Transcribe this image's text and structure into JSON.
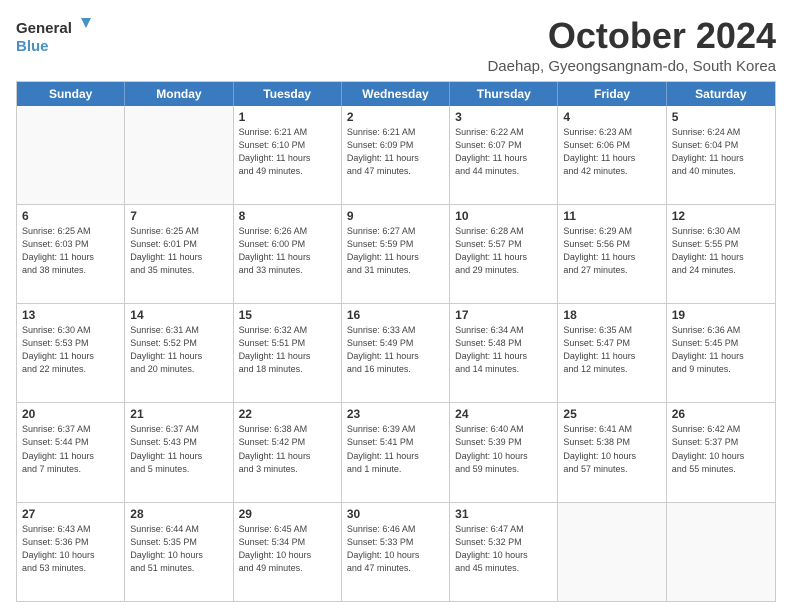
{
  "logo": {
    "line1": "General",
    "line2": "Blue",
    "icon_color": "#4a90c4"
  },
  "header": {
    "month": "October 2024",
    "location": "Daehap, Gyeongsangnam-do, South Korea"
  },
  "weekdays": [
    "Sunday",
    "Monday",
    "Tuesday",
    "Wednesday",
    "Thursday",
    "Friday",
    "Saturday"
  ],
  "rows": [
    [
      {
        "num": "",
        "info": ""
      },
      {
        "num": "",
        "info": ""
      },
      {
        "num": "1",
        "info": "Sunrise: 6:21 AM\nSunset: 6:10 PM\nDaylight: 11 hours\nand 49 minutes."
      },
      {
        "num": "2",
        "info": "Sunrise: 6:21 AM\nSunset: 6:09 PM\nDaylight: 11 hours\nand 47 minutes."
      },
      {
        "num": "3",
        "info": "Sunrise: 6:22 AM\nSunset: 6:07 PM\nDaylight: 11 hours\nand 44 minutes."
      },
      {
        "num": "4",
        "info": "Sunrise: 6:23 AM\nSunset: 6:06 PM\nDaylight: 11 hours\nand 42 minutes."
      },
      {
        "num": "5",
        "info": "Sunrise: 6:24 AM\nSunset: 6:04 PM\nDaylight: 11 hours\nand 40 minutes."
      }
    ],
    [
      {
        "num": "6",
        "info": "Sunrise: 6:25 AM\nSunset: 6:03 PM\nDaylight: 11 hours\nand 38 minutes."
      },
      {
        "num": "7",
        "info": "Sunrise: 6:25 AM\nSunset: 6:01 PM\nDaylight: 11 hours\nand 35 minutes."
      },
      {
        "num": "8",
        "info": "Sunrise: 6:26 AM\nSunset: 6:00 PM\nDaylight: 11 hours\nand 33 minutes."
      },
      {
        "num": "9",
        "info": "Sunrise: 6:27 AM\nSunset: 5:59 PM\nDaylight: 11 hours\nand 31 minutes."
      },
      {
        "num": "10",
        "info": "Sunrise: 6:28 AM\nSunset: 5:57 PM\nDaylight: 11 hours\nand 29 minutes."
      },
      {
        "num": "11",
        "info": "Sunrise: 6:29 AM\nSunset: 5:56 PM\nDaylight: 11 hours\nand 27 minutes."
      },
      {
        "num": "12",
        "info": "Sunrise: 6:30 AM\nSunset: 5:55 PM\nDaylight: 11 hours\nand 24 minutes."
      }
    ],
    [
      {
        "num": "13",
        "info": "Sunrise: 6:30 AM\nSunset: 5:53 PM\nDaylight: 11 hours\nand 22 minutes."
      },
      {
        "num": "14",
        "info": "Sunrise: 6:31 AM\nSunset: 5:52 PM\nDaylight: 11 hours\nand 20 minutes."
      },
      {
        "num": "15",
        "info": "Sunrise: 6:32 AM\nSunset: 5:51 PM\nDaylight: 11 hours\nand 18 minutes."
      },
      {
        "num": "16",
        "info": "Sunrise: 6:33 AM\nSunset: 5:49 PM\nDaylight: 11 hours\nand 16 minutes."
      },
      {
        "num": "17",
        "info": "Sunrise: 6:34 AM\nSunset: 5:48 PM\nDaylight: 11 hours\nand 14 minutes."
      },
      {
        "num": "18",
        "info": "Sunrise: 6:35 AM\nSunset: 5:47 PM\nDaylight: 11 hours\nand 12 minutes."
      },
      {
        "num": "19",
        "info": "Sunrise: 6:36 AM\nSunset: 5:45 PM\nDaylight: 11 hours\nand 9 minutes."
      }
    ],
    [
      {
        "num": "20",
        "info": "Sunrise: 6:37 AM\nSunset: 5:44 PM\nDaylight: 11 hours\nand 7 minutes."
      },
      {
        "num": "21",
        "info": "Sunrise: 6:37 AM\nSunset: 5:43 PM\nDaylight: 11 hours\nand 5 minutes."
      },
      {
        "num": "22",
        "info": "Sunrise: 6:38 AM\nSunset: 5:42 PM\nDaylight: 11 hours\nand 3 minutes."
      },
      {
        "num": "23",
        "info": "Sunrise: 6:39 AM\nSunset: 5:41 PM\nDaylight: 11 hours\nand 1 minute."
      },
      {
        "num": "24",
        "info": "Sunrise: 6:40 AM\nSunset: 5:39 PM\nDaylight: 10 hours\nand 59 minutes."
      },
      {
        "num": "25",
        "info": "Sunrise: 6:41 AM\nSunset: 5:38 PM\nDaylight: 10 hours\nand 57 minutes."
      },
      {
        "num": "26",
        "info": "Sunrise: 6:42 AM\nSunset: 5:37 PM\nDaylight: 10 hours\nand 55 minutes."
      }
    ],
    [
      {
        "num": "27",
        "info": "Sunrise: 6:43 AM\nSunset: 5:36 PM\nDaylight: 10 hours\nand 53 minutes."
      },
      {
        "num": "28",
        "info": "Sunrise: 6:44 AM\nSunset: 5:35 PM\nDaylight: 10 hours\nand 51 minutes."
      },
      {
        "num": "29",
        "info": "Sunrise: 6:45 AM\nSunset: 5:34 PM\nDaylight: 10 hours\nand 49 minutes."
      },
      {
        "num": "30",
        "info": "Sunrise: 6:46 AM\nSunset: 5:33 PM\nDaylight: 10 hours\nand 47 minutes."
      },
      {
        "num": "31",
        "info": "Sunrise: 6:47 AM\nSunset: 5:32 PM\nDaylight: 10 hours\nand 45 minutes."
      },
      {
        "num": "",
        "info": ""
      },
      {
        "num": "",
        "info": ""
      }
    ]
  ]
}
